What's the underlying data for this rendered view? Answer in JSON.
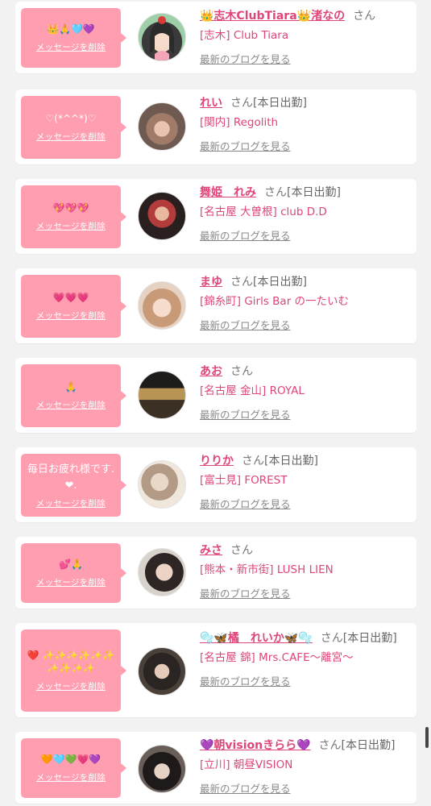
{
  "common": {
    "delete_label": "メッセージを削除",
    "blog_label": "最新のブログを見る",
    "san": "さん"
  },
  "colors": {
    "bubble": "#ff9eb0",
    "accent": "#e0457a",
    "background": "#f2f2f2"
  },
  "items": [
    {
      "message": "👑🙏🩵💜",
      "name": "👑志木ClubTiara👑渚なの",
      "status": "",
      "shop": "[志木] Club Tiara"
    },
    {
      "message": "♡(*^^*)♡",
      "name": "れい",
      "status": "[本日出勤]",
      "shop": "[関内] Regolith"
    },
    {
      "message": "💖💖💖",
      "name": "舞姫　れみ",
      "status": "[本日出勤]",
      "shop": "[名古屋 大曽根] club D.D"
    },
    {
      "message": "💗💗💗",
      "name": "まゆ",
      "status": "[本日出勤]",
      "shop": "[錦糸町] Girls Bar の一たいむ"
    },
    {
      "message": "🙏",
      "name": "あお",
      "status": "",
      "shop": "[名古屋 金山] ROYAL"
    },
    {
      "message": "毎日お疲れ様です.❤.",
      "name": "りりか",
      "status": "[本日出勤]",
      "shop": "[富士見] FOREST"
    },
    {
      "message": "💕🙏",
      "name": "みさ",
      "status": "",
      "shop": "[熊本・新市街] LUSH LIEN"
    },
    {
      "message": "❤️ ✨✨✨✨✨✨ ✨✨✨✨",
      "name": "🫧🦋橘　れいか🦋🫧",
      "status": "[本日出勤]",
      "shop": "[名古屋 錦] Mrs.CAFE〜離宮〜"
    },
    {
      "message": "🧡🩵💚💗💜",
      "name": "💜朝visionきらら💜",
      "status": "[本日出勤]",
      "shop": "[立川] 朝昼VISION"
    }
  ]
}
